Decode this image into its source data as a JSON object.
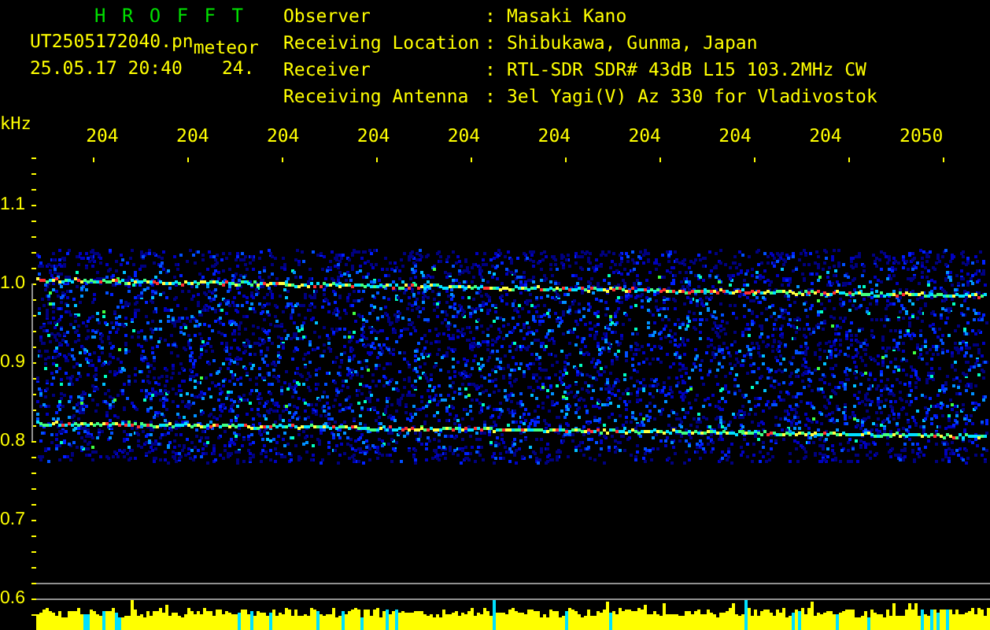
{
  "header": {
    "title": "H R O F F T",
    "file_name": "UT2505172040.pn",
    "tag": "meteor",
    "date_time": "25.05.17 20:40",
    "number": "24.",
    "info": [
      {
        "label": "Observer",
        "separator": ":",
        "value": "Masaki Kano"
      },
      {
        "label": "Receiving Location",
        "separator": ":",
        "value": "Shibukawa, Gunma, Japan"
      },
      {
        "label": "Receiver",
        "separator": ":",
        "value": "RTL-SDR SDR# 43dB L15 103.2MHz CW"
      },
      {
        "label": "Receiving Antenna",
        "separator": ":",
        "value": "3el Yagi(V) Az 330 for Vladivostok"
      }
    ]
  },
  "x_axis": {
    "unit": "kHz",
    "labels": [
      "204",
      "204",
      "204",
      "204",
      "204",
      "204",
      "204",
      "204",
      "204",
      "2050"
    ]
  },
  "y_axis": {
    "labels": [
      "1.1",
      "1.0",
      "0.9",
      "0.8",
      "0.7",
      "0.6"
    ]
  }
}
